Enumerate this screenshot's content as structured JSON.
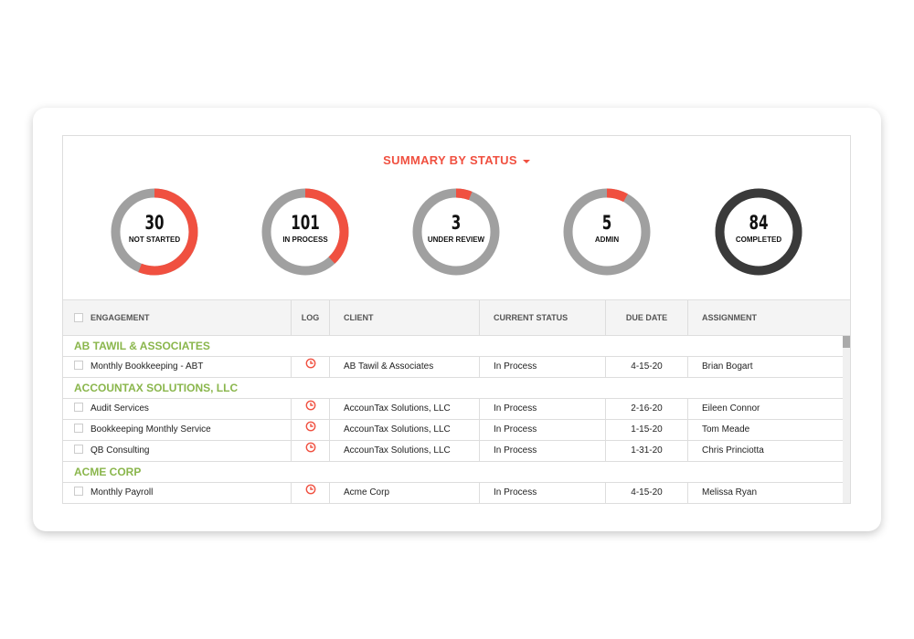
{
  "summary": {
    "title": "SUMMARY BY STATUS",
    "statuses": [
      {
        "count": "30",
        "label": "NOT STARTED",
        "fraction": 0.56,
        "color": "#f05040"
      },
      {
        "count": "101",
        "label": "IN PROCESS",
        "fraction": 0.38,
        "color": "#f05040"
      },
      {
        "count": "3",
        "label": "UNDER REVIEW",
        "fraction": 0.06,
        "color": "#f05040"
      },
      {
        "count": "5",
        "label": "ADMIN",
        "fraction": 0.08,
        "color": "#f05040"
      },
      {
        "count": "84",
        "label": "COMPLETED",
        "fraction": 1.0,
        "color": "#3a3a3a"
      }
    ],
    "track_color": "#a0a0a0"
  },
  "table": {
    "columns": [
      "ENGAGEMENT",
      "LOG",
      "CLIENT",
      "CURRENT STATUS",
      "DUE DATE",
      "ASSIGNMENT"
    ],
    "groups": [
      {
        "name": "AB TAWIL & ASSOCIATES",
        "rows": [
          {
            "engagement": "Monthly Bookkeeping - ABT",
            "client": "AB Tawil & Associates",
            "status": "In Process",
            "due": "4-15-20",
            "assignment": "Brian Bogart"
          }
        ]
      },
      {
        "name": "ACCOUNTAX SOLUTIONS, LLC",
        "rows": [
          {
            "engagement": "Audit Services",
            "client": "AccounTax Solutions, LLC",
            "status": "In Process",
            "due": "2-16-20",
            "assignment": "Eileen Connor"
          },
          {
            "engagement": "Bookkeeping Monthly Service",
            "client": "AccounTax Solutions, LLC",
            "status": "In Process",
            "due": "1-15-20",
            "assignment": "Tom Meade"
          },
          {
            "engagement": "QB Consulting",
            "client": "AccounTax Solutions, LLC",
            "status": "In Process",
            "due": "1-31-20",
            "assignment": "Chris Princiotta"
          }
        ]
      },
      {
        "name": "ACME CORP",
        "rows": [
          {
            "engagement": "Monthly Payroll",
            "client": "Acme Corp",
            "status": "In Process",
            "due": "4-15-20",
            "assignment": "Melissa Ryan"
          }
        ]
      }
    ],
    "log_icon": "clock-icon",
    "accent_color": "#f05040",
    "group_color": "#8ab64c"
  }
}
